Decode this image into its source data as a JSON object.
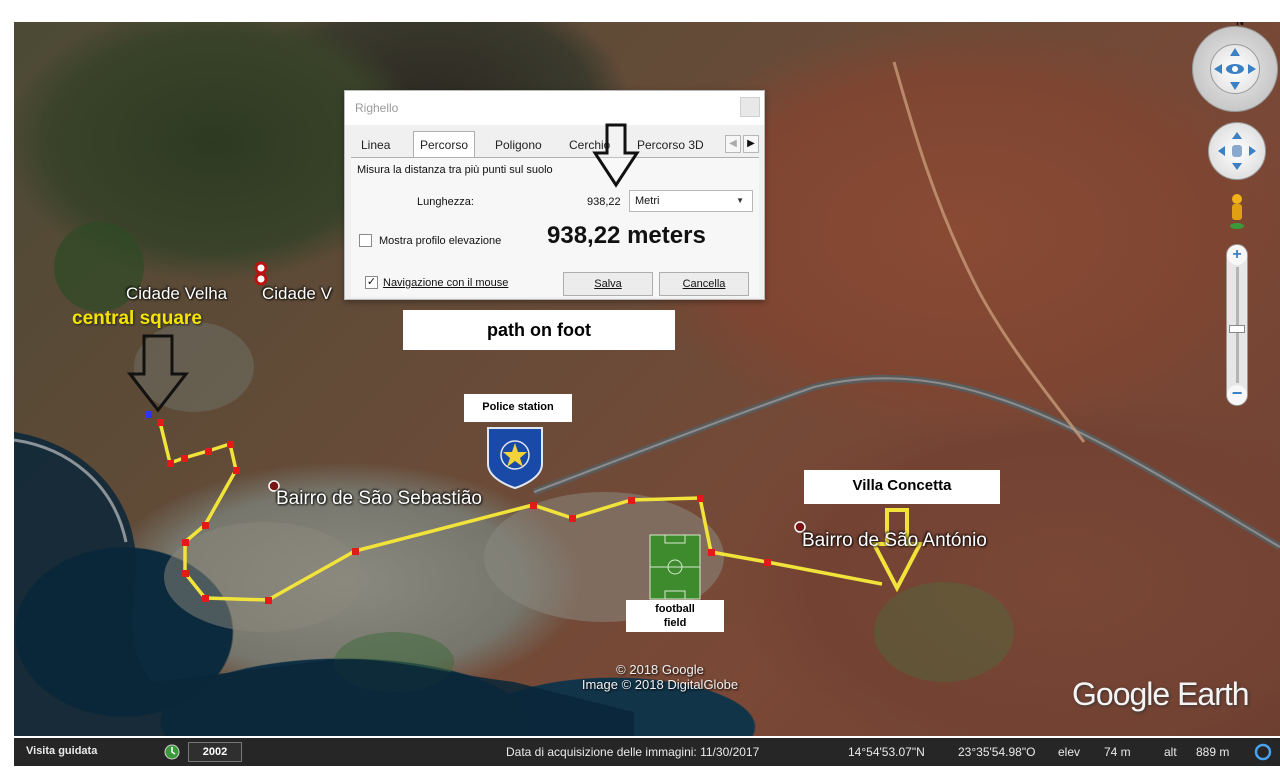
{
  "ruler_dialog": {
    "title": "Righello",
    "tabs": [
      "Linea",
      "Percorso",
      "Poligono",
      "Cerchio",
      "Percorso 3D"
    ],
    "active_tab": "Percorso",
    "description": "Misura la distanza tra più punti sul suolo",
    "length_label": "Lunghezza:",
    "length_value": "938,22",
    "unit": "Metri",
    "elevation_profile_label": "Mostra profilo elevazione",
    "elevation_profile_checked": false,
    "mouse_nav_label": "Navigazione con il mouse",
    "mouse_nav_checked": true,
    "save_label": "Salva",
    "cancel_label": "Cancella"
  },
  "annotations": {
    "meters_text": "938,22 meters",
    "path_label": "path on foot",
    "police_label": "Police station",
    "villa_label": "Villa Concetta",
    "football_label_line1": "football",
    "football_label_line2": "field",
    "central_square_label": "central square"
  },
  "map_labels": {
    "cidade_velha": "Cidade Velha",
    "cidade_v": "Cidade V",
    "sao_sebastiao": "Bairro de São Sebastião",
    "sao_antonio": "Bairro de São António",
    "copyright_line1": "© 2018 Google",
    "copyright_line2": "Image © 2018 DigitalGlobe",
    "google_earth": "Google Earth"
  },
  "status_bar": {
    "tour_label": "Visita guidata",
    "year": "2002",
    "acquisition_date": "Data di acquisizione delle immagini: 11/30/2017",
    "latitude": "14°54'53.07\"N",
    "longitude": "23°35'54.98\"O",
    "elev_label": "elev",
    "elev_value": "74 m",
    "alt_label": "alt",
    "alt_value": "889 m"
  },
  "compass_label": "N",
  "colors": {
    "route": "#f2e33a",
    "route_node": "#e21a1a",
    "annotation_yellow": "#f5e400",
    "statusbar_bg": "#262626"
  }
}
